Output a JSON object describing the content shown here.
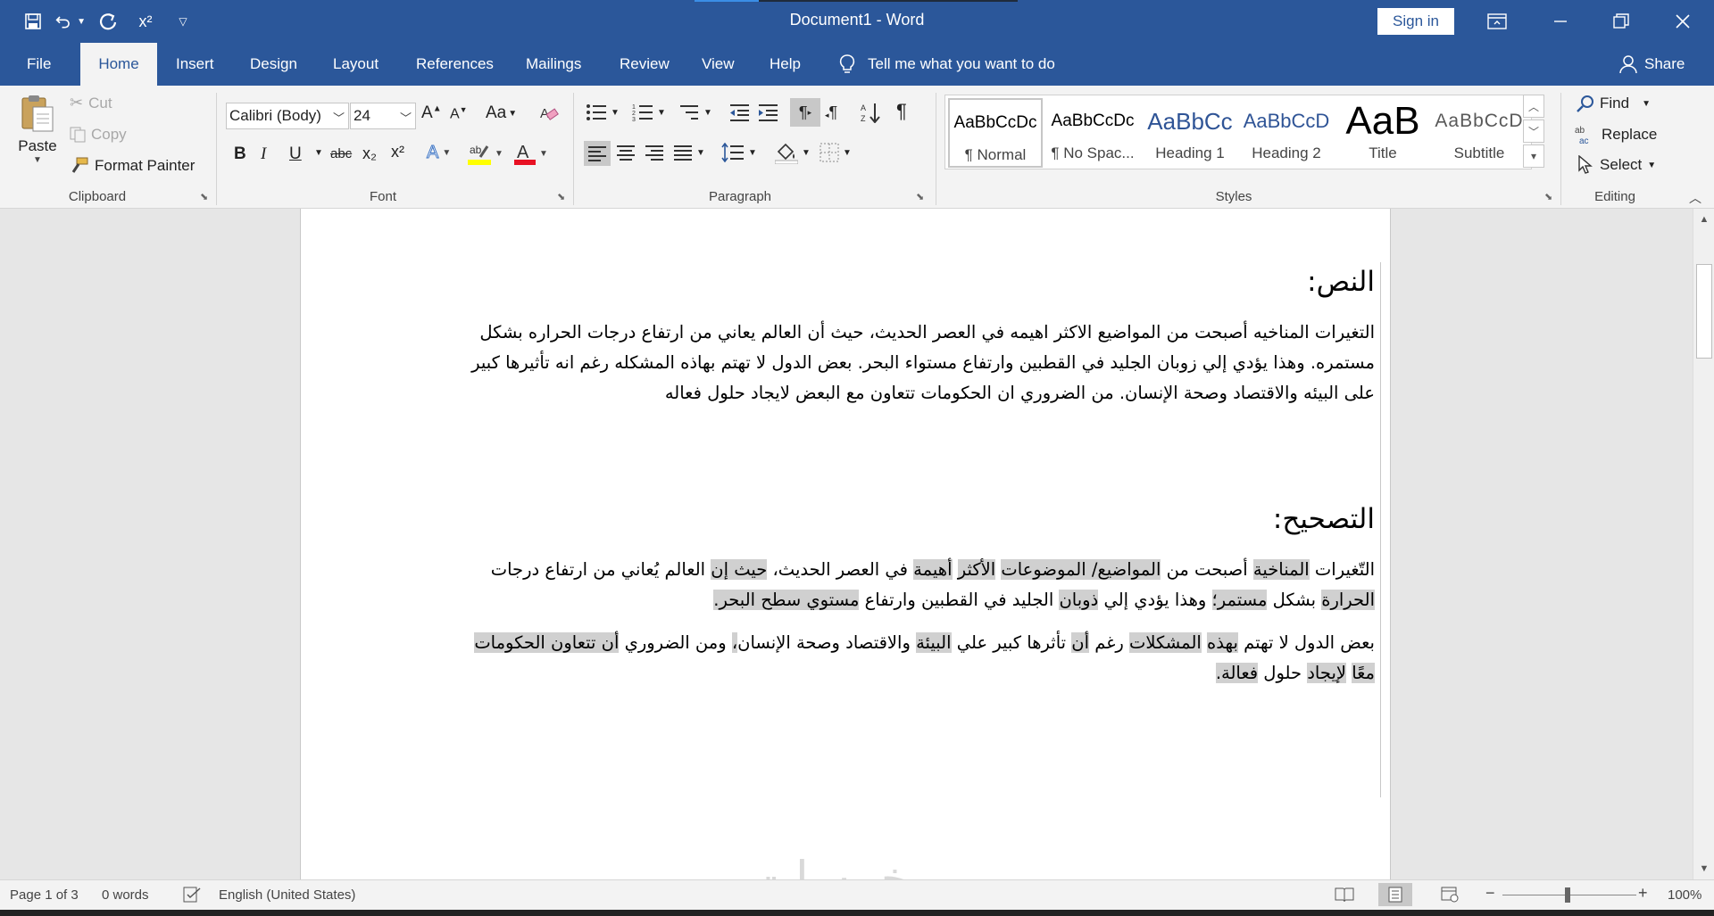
{
  "titlebar": {
    "title": "Document1  -  Word",
    "signin": "Sign in",
    "qat_superscript": "x²"
  },
  "tabs": [
    "File",
    "Home",
    "Insert",
    "Design",
    "Layout",
    "References",
    "Mailings",
    "Review",
    "View",
    "Help"
  ],
  "tell_me": "Tell me what you want to do",
  "share": "Share",
  "clipboard": {
    "paste": "Paste",
    "cut": "Cut",
    "copy": "Copy",
    "format_painter": "Format Painter",
    "label": "Clipboard"
  },
  "font": {
    "name": "Calibri (Body)",
    "size": "24",
    "label": "Font",
    "change_case": "Aa",
    "bold": "B",
    "italic": "I",
    "underline": "U",
    "strike": "abc",
    "subscript": "x₂",
    "superscript": "x²"
  },
  "paragraph": {
    "label": "Paragraph"
  },
  "styles": {
    "label": "Styles",
    "items": [
      {
        "sample": "AaBbCcDc",
        "name": "¶ Normal"
      },
      {
        "sample": "AaBbCcDc",
        "name": "¶ No Spac..."
      },
      {
        "sample": "AaBbCc",
        "name": "Heading 1"
      },
      {
        "sample": "AaBbCcD",
        "name": "Heading 2"
      },
      {
        "sample": "AaB",
        "name": "Title"
      },
      {
        "sample": "AaBbCcD",
        "name": "Subtitle"
      }
    ]
  },
  "editing": {
    "find": "Find",
    "replace": "Replace",
    "select": "Select",
    "label": "Editing"
  },
  "document": {
    "heading1": "النص:",
    "paragraph1": "التغيرات المناخيه أصبحت من المواضيع الاكثر اهيمه في العصر الحديث، حيث أن العالم يعاني من ارتفاع درجات الحراره بشكل مستمره. وهذا يؤدي إلي زوبان الجليد في القطبين وارتفاع مستواء البحر. بعض الدول لا تهتم بهاذه المشكله رغم انه تأثيرها كبير على البيئه والاقتصاد وصحة الإنسان. من الضروري ان الحكومات تتعاون مع البعض لايجاد حلول فعاله",
    "heading2": "التصحيح:",
    "p2_segments": [
      {
        "t": "التّغيرات ",
        "h": false
      },
      {
        "t": "المناخية",
        "h": true
      },
      {
        "t": " أصبحت من ",
        "h": false
      },
      {
        "t": "المواضيع/ الموضوعات",
        "h": true
      },
      {
        "t": " ",
        "h": false
      },
      {
        "t": "الأكثر",
        "h": true
      },
      {
        "t": " ",
        "h": false
      },
      {
        "t": "أهيمة",
        "h": true
      },
      {
        "t": " في العصر الحديث، ",
        "h": false
      },
      {
        "t": "حيث إن",
        "h": true
      },
      {
        "t": " العالم يُعاني من ارتفاع درجات ",
        "h": false
      },
      {
        "t": "الحرارة",
        "h": true
      },
      {
        "t": " بشكل ",
        "h": false
      },
      {
        "t": "مستمر؛",
        "h": true
      },
      {
        "t": " وهذا يؤدي إلي ",
        "h": false
      },
      {
        "t": "ذوبان",
        "h": true
      },
      {
        "t": " الجليد في القطبين وارتفاع ",
        "h": false
      },
      {
        "t": "مستوي سطح البحر.",
        "h": true
      }
    ],
    "p3_segments": [
      {
        "t": "بعض الدول لا تهتم ",
        "h": false
      },
      {
        "t": "بهذه",
        "h": true
      },
      {
        "t": " ",
        "h": false
      },
      {
        "t": "المشكلات",
        "h": true
      },
      {
        "t": " رغم ",
        "h": false
      },
      {
        "t": "أن",
        "h": true
      },
      {
        "t": " تأثرها كبير علي ",
        "h": false
      },
      {
        "t": "البيئة",
        "h": true
      },
      {
        "t": " والاقتصاد وصحة الإنسان",
        "h": false
      },
      {
        "t": "،",
        "h": true
      },
      {
        "t": " ومن الضروري ",
        "h": false
      },
      {
        "t": "أن تتعاون الحكومات معًا",
        "h": true
      },
      {
        "t": " ",
        "h": false
      },
      {
        "t": "لإيجاد",
        "h": true
      },
      {
        "t": " حلول ",
        "h": false
      },
      {
        "t": "فعالة.",
        "h": true
      }
    ]
  },
  "watermark": "خمسات",
  "status": {
    "page": "Page 1 of 3",
    "words": "0 words",
    "language": "English (United States)",
    "zoom": "100%"
  }
}
